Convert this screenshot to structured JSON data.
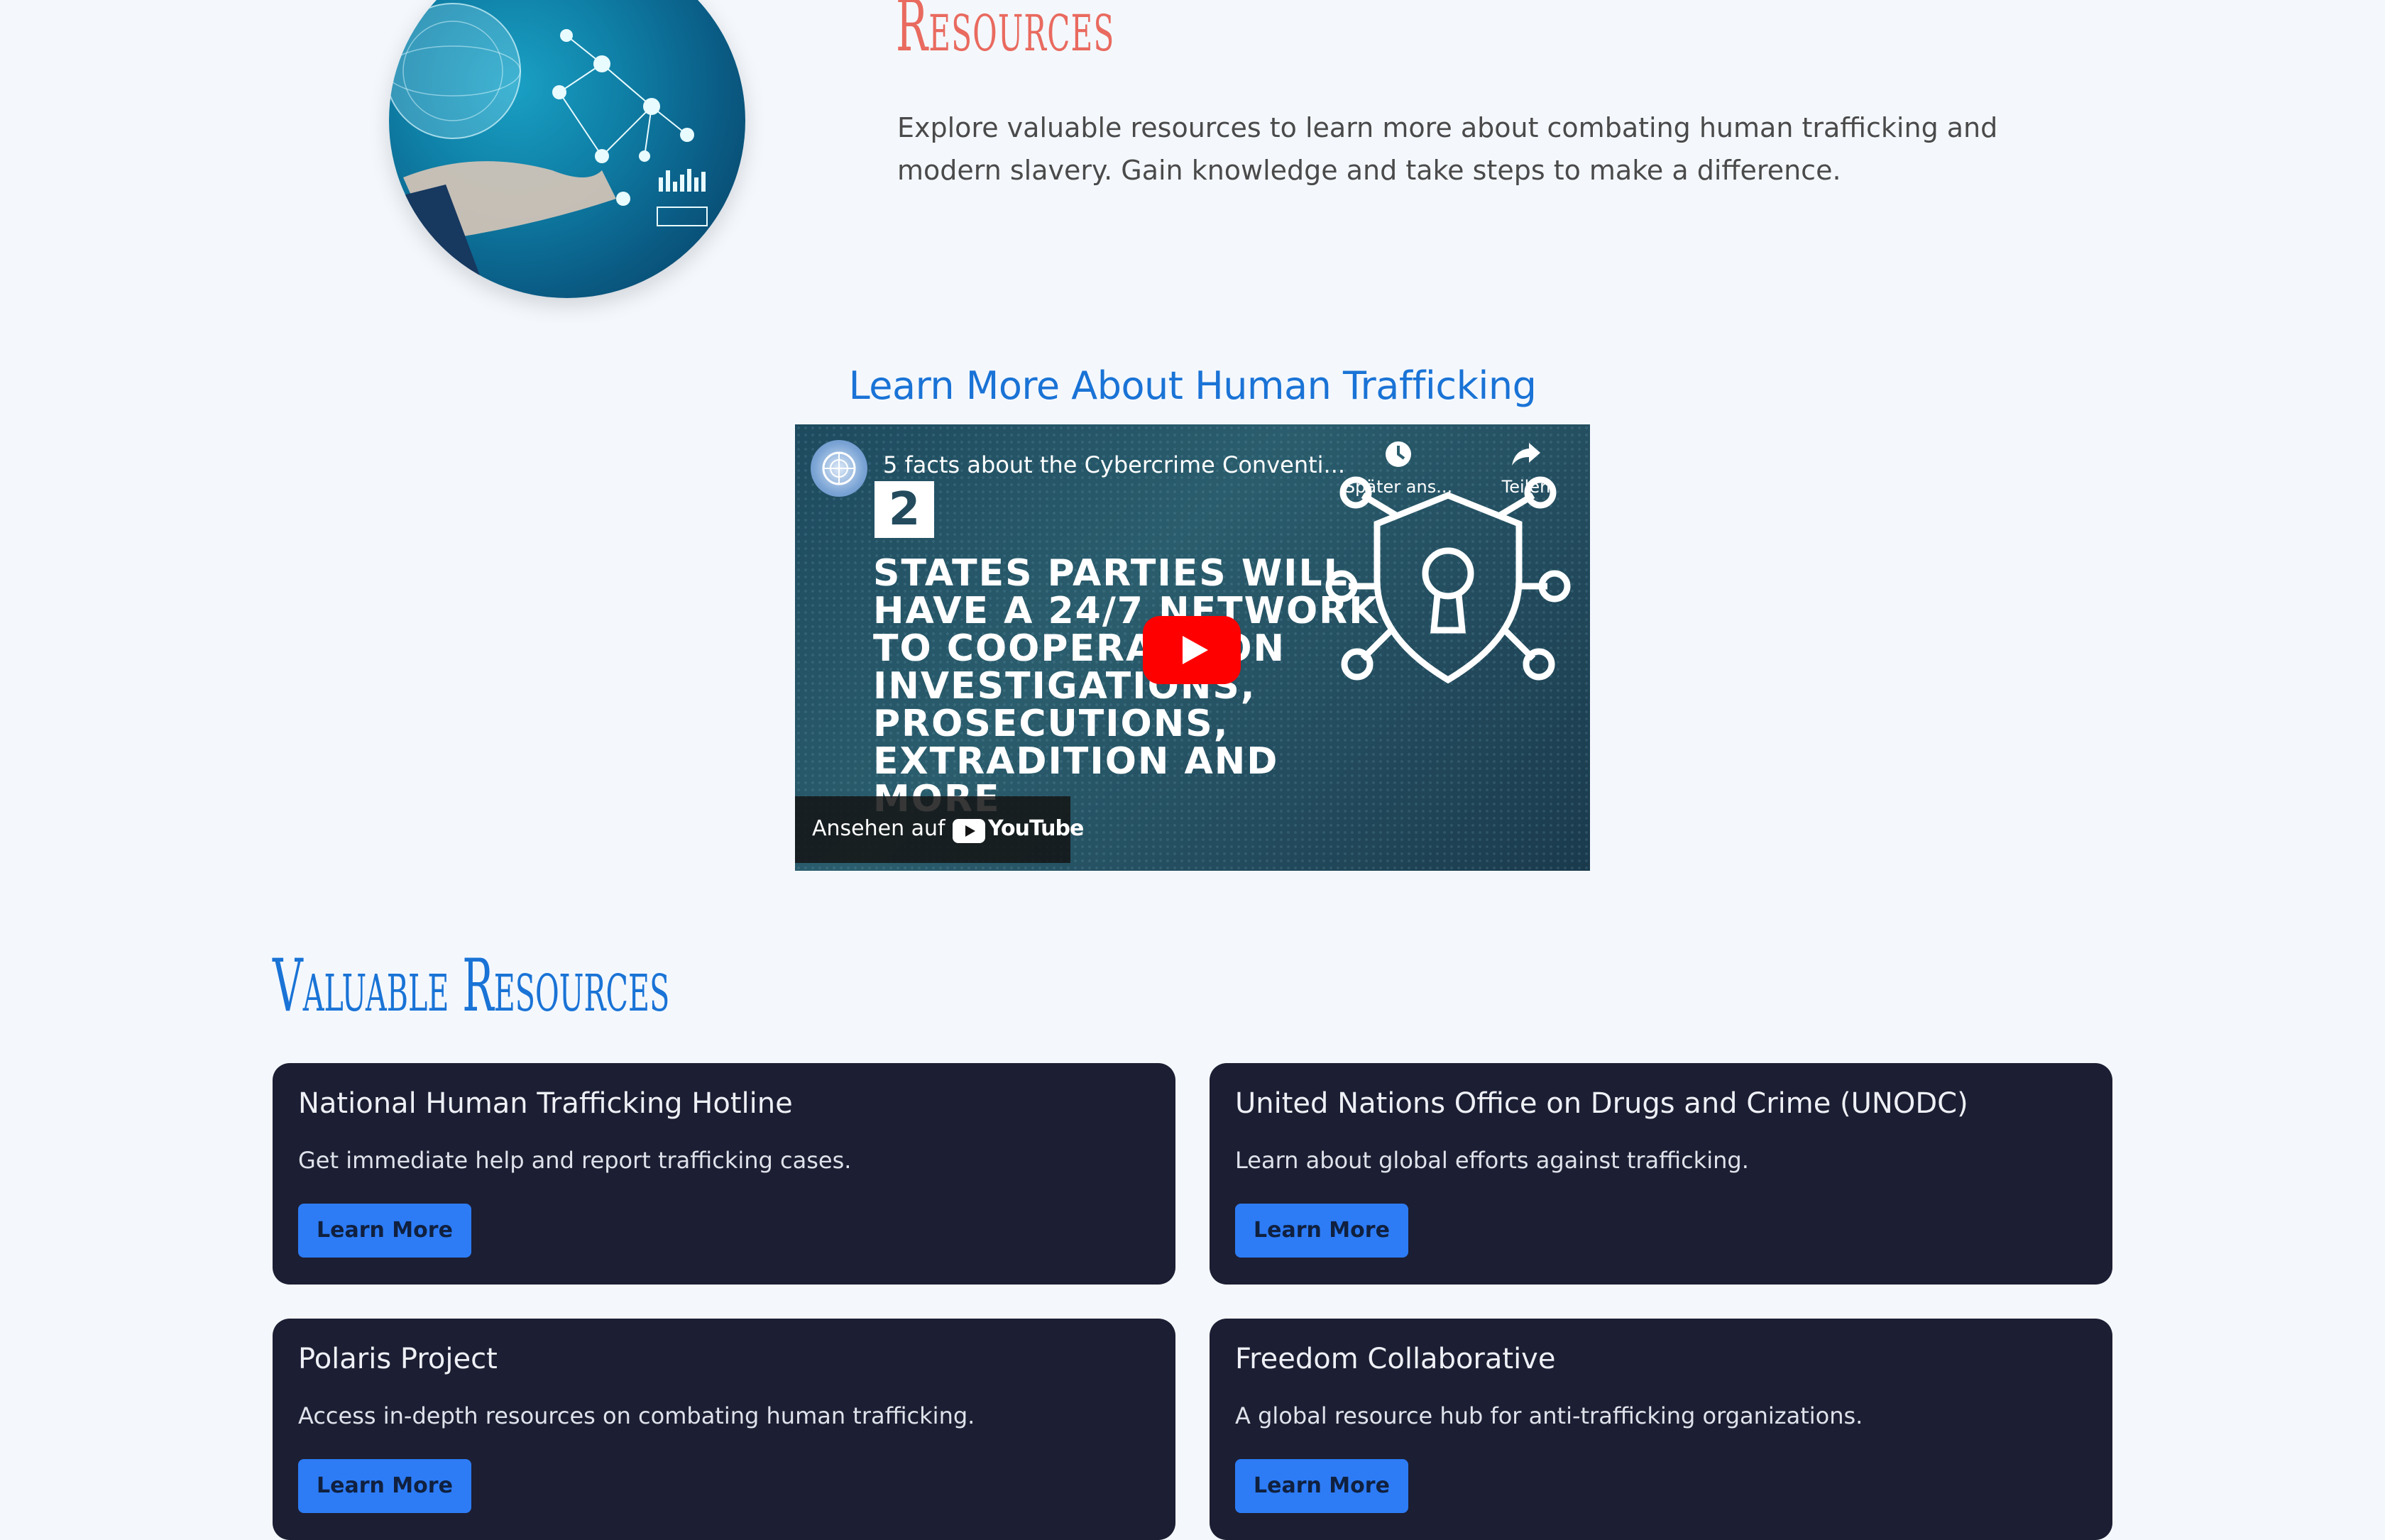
{
  "header": {
    "title": "Resources",
    "description": "Explore valuable resources to learn more about combating human trafficking and modern slavery. Gain knowledge and take steps to make a difference."
  },
  "video_section": {
    "heading": "Learn More About Human Trafficking",
    "video_title": "5 facts about the Cybercrime Conventi...",
    "number": "2",
    "headline": "STATES PARTIES WILL\nHAVE A 24/7 NETWORK\nTO COOPERATE ON\nINVESTIGATIONS,\nPROSECUTIONS,\nEXTRADITION AND MORE",
    "later_label": "Später ans...",
    "share_label": "Teilen",
    "watch_on_label": "Ansehen auf",
    "youtube_label": "YouTube"
  },
  "valuable": {
    "title": "Valuable Resources",
    "cards": [
      {
        "title": "National Human Trafficking Hotline",
        "description": "Get immediate help and report trafficking cases.",
        "button": "Learn More"
      },
      {
        "title": "United Nations Office on Drugs and Crime (UNODC)",
        "description": "Learn about global efforts against trafficking.",
        "button": "Learn More"
      },
      {
        "title": "Polaris Project",
        "description": "Access in-depth resources on combating human trafficking.",
        "button": "Learn More"
      },
      {
        "title": "Freedom Collaborative",
        "description": "A global resource hub for anti-trafficking organizations.",
        "button": "Learn More"
      }
    ]
  },
  "colors": {
    "background": "#f4f8fd",
    "title_coral": "#e96a5f",
    "accent_blue": "#1a73d6",
    "card_bg": "#1c1e33",
    "button_blue": "#2d7cf6",
    "youtube_red": "#ff0000"
  },
  "icons": [
    "globe-network-illustration",
    "un-logo-icon",
    "shield-keyhole-icon",
    "clock-icon",
    "share-icon",
    "play-icon",
    "youtube-logo-icon"
  ]
}
